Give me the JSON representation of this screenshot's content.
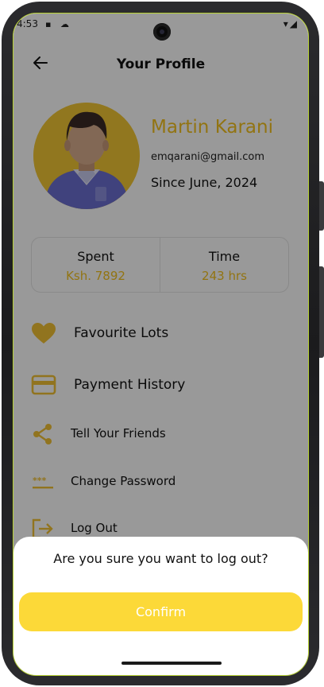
{
  "status_bar": {
    "time": "4:53"
  },
  "appbar": {
    "title": "Your Profile"
  },
  "profile": {
    "name": "Martin Karani",
    "email": "emqarani@gmail.com",
    "since": "Since June, 2024"
  },
  "stats": [
    {
      "label": "Spent",
      "value": "Ksh. 7892"
    },
    {
      "label": "Time",
      "value": "243 hrs"
    }
  ],
  "menu": [
    {
      "label": "Favourite Lots",
      "icon": "heart-icon"
    },
    {
      "label": "Payment History",
      "icon": "credit-card-icon"
    },
    {
      "label": "Tell Your Friends",
      "icon": "share-icon"
    },
    {
      "label": "Change Password",
      "icon": "password-icon"
    },
    {
      "label": "Log Out",
      "icon": "logout-icon"
    }
  ],
  "dialog": {
    "question": "Are you sure you want to log out?",
    "confirm_label": "Confirm"
  },
  "colors": {
    "accent": "#f4c21f",
    "button": "#fcd938"
  }
}
